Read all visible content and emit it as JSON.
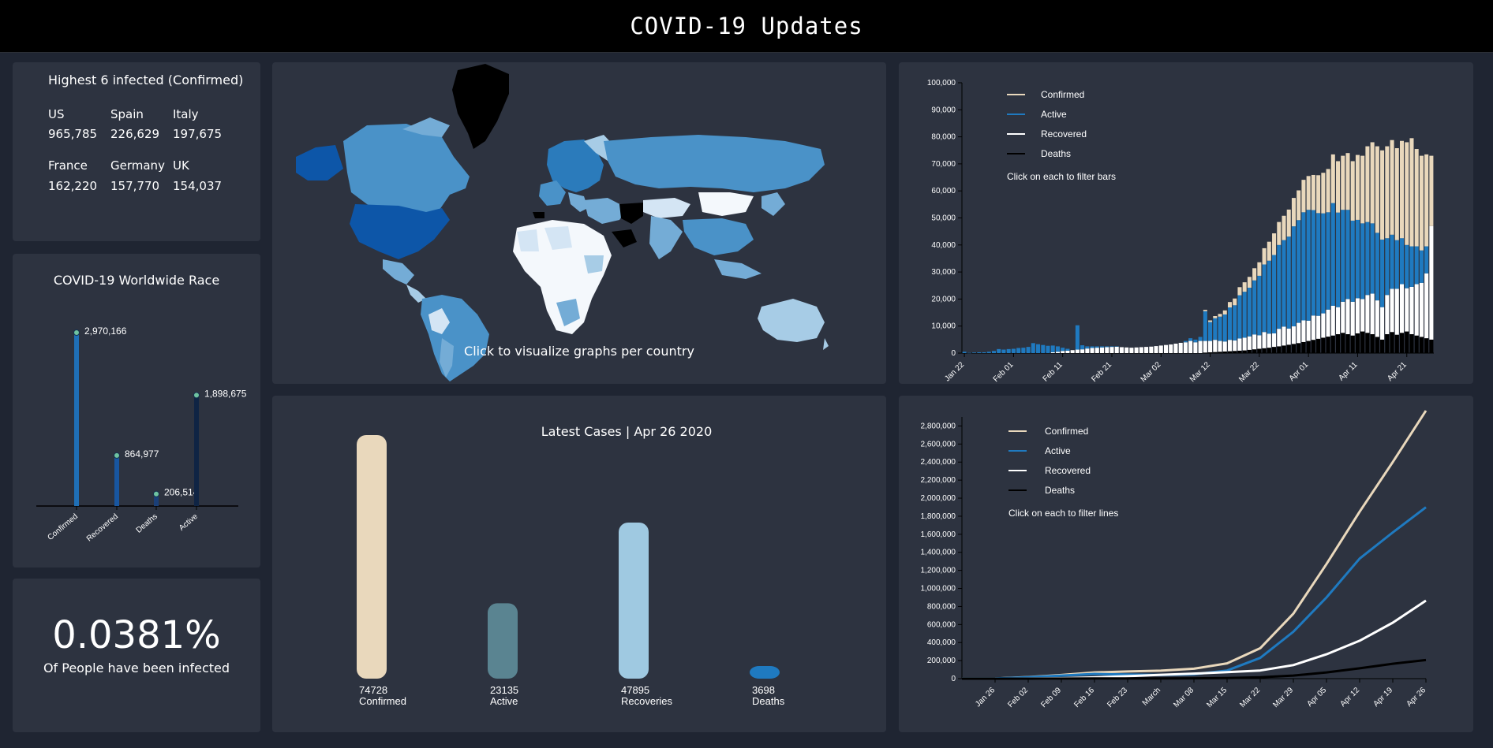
{
  "header": {
    "title": "COVID-19 Updates"
  },
  "top_infected": {
    "title": "Highest 6 infected (Confirmed)",
    "countries": [
      {
        "name": "US",
        "value": "965,785"
      },
      {
        "name": "Spain",
        "value": "226,629"
      },
      {
        "name": "Italy",
        "value": "197,675"
      },
      {
        "name": "France",
        "value": "162,220"
      },
      {
        "name": "Germany",
        "value": "157,770"
      },
      {
        "name": "UK",
        "value": "154,037"
      }
    ]
  },
  "map": {
    "hint": "Click to visualize graphs per country"
  },
  "percent": {
    "value": "0.0381%",
    "caption": "Of People have been infected"
  },
  "colors": {
    "confirmed": "#e9d8bc",
    "active": "#1f7ac0",
    "recovered": "#ffffff",
    "deaths": "#000000",
    "panel": "#2d3340",
    "background": "#1f2532",
    "latest_active": "#5a8491",
    "latest_recovered": "#9fc9e1",
    "latest_deaths": "#1f7ac0",
    "race_confirmed": "#1f6fb6",
    "race_recovered": "#1856a0",
    "race_deaths": "#1a3f78",
    "race_active": "#0f2444",
    "map_palette": [
      "#0d56a8",
      "#2b7bbb",
      "#4a92c8",
      "#74acd6",
      "#a7cce6",
      "#d4e5f4",
      "#f4f8fc",
      "#000000"
    ]
  },
  "chart_data": [
    {
      "id": "race",
      "type": "lollipop",
      "title": "COVID-19 Worldwide Race",
      "categories": [
        "Confirmed",
        "Recovered",
        "Deaths",
        "Active"
      ],
      "values": [
        2970166,
        864977,
        206514,
        1898675
      ],
      "value_labels": [
        "2,970,166",
        "864,977",
        "206,514",
        "1,898,675"
      ]
    },
    {
      "id": "latest",
      "type": "bar",
      "title": "Latest Cases | Apr 26 2020",
      "categories": [
        "Confirmed",
        "Active",
        "Recoveries",
        "Deaths"
      ],
      "values": [
        74728,
        23135,
        47895,
        3698
      ]
    },
    {
      "id": "daily",
      "type": "bar",
      "stacked": true,
      "ylim": [
        0,
        100000
      ],
      "yticks": [
        0,
        10000,
        20000,
        30000,
        40000,
        50000,
        60000,
        70000,
        80000,
        90000,
        100000
      ],
      "ytick_labels": [
        "0",
        "10,000",
        "20,000",
        "30,000",
        "40,000",
        "50,000",
        "60,000",
        "70,000",
        "80,000",
        "90,000",
        "100,000"
      ],
      "xtick_labels": [
        "Jan 22",
        "Feb 01",
        "Feb 11",
        "Feb 21",
        "Mar 02",
        "Mar 12",
        "Mar 22",
        "Apr 01",
        "Apr 11",
        "Apr 21"
      ],
      "legend": [
        "Confirmed",
        "Active",
        "Recovered",
        "Deaths"
      ],
      "legend_note": "Click on each to filter bars",
      "dates_start": "Jan 22",
      "series": [
        {
          "name": "Deaths",
          "values": [
            0,
            0,
            0,
            0,
            0,
            0,
            0,
            0,
            0,
            0,
            0,
            0,
            0,
            0,
            0,
            0,
            0,
            0,
            0,
            0,
            0,
            0,
            0,
            0,
            0,
            0,
            0,
            0,
            0,
            0,
            0,
            0,
            0,
            0,
            0,
            0,
            0,
            0,
            0,
            0,
            0,
            0,
            0,
            0,
            0,
            0,
            0,
            0,
            0,
            200,
            300,
            400,
            500,
            600,
            700,
            800,
            900,
            1000,
            1200,
            1400,
            1600,
            1800,
            2000,
            2300,
            2500,
            2800,
            3100,
            3400,
            3700,
            4100,
            4500,
            4900,
            5300,
            5700,
            6100,
            6500,
            7000,
            7500,
            7000,
            6500,
            7300,
            8000,
            7500,
            7000,
            6000,
            5000,
            7000,
            7800,
            6800,
            7500,
            8000,
            7000,
            6500,
            6000,
            5500,
            5000
          ]
        },
        {
          "name": "Recovered",
          "values": [
            0,
            0,
            0,
            0,
            0,
            0,
            0,
            0,
            0,
            0,
            0,
            0,
            0,
            0,
            0,
            0,
            0,
            0,
            300,
            500,
            800,
            900,
            1100,
            1300,
            1400,
            1700,
            1900,
            2000,
            2100,
            2200,
            2300,
            2400,
            2200,
            2100,
            2000,
            2100,
            2200,
            2300,
            2400,
            2600,
            2800,
            3000,
            3200,
            3500,
            3800,
            4000,
            4500,
            4000,
            4500,
            4300,
            4200,
            4500,
            4000,
            3700,
            4200,
            3900,
            4500,
            4700,
            5000,
            5500,
            5000,
            6000,
            5200,
            5000,
            6500,
            7000,
            6000,
            6500,
            7500,
            8000,
            7500,
            9000,
            8500,
            9000,
            10000,
            11000,
            10000,
            11500,
            13000,
            12500,
            13000,
            12000,
            14000,
            15000,
            13500,
            12000,
            14500,
            16000,
            17000,
            18000,
            16000,
            17500,
            19000,
            20000,
            24000,
            42000
          ]
        },
        {
          "name": "Active",
          "values": [
            500,
            100,
            200,
            300,
            300,
            500,
            800,
            1500,
            1300,
            1500,
            1600,
            1900,
            2000,
            2300,
            3700,
            3300,
            3000,
            2700,
            2500,
            2000,
            1200,
            700,
            0,
            9000,
            1500,
            800,
            600,
            500,
            400,
            300,
            200,
            100,
            0,
            0,
            0,
            0,
            0,
            0,
            0,
            0,
            0,
            0,
            0,
            0,
            0,
            500,
            1000,
            1000,
            1500,
            11000,
            7000,
            8000,
            9000,
            10000,
            12000,
            13000,
            16000,
            17000,
            18000,
            20000,
            22000,
            25000,
            27000,
            29000,
            31000,
            32000,
            34000,
            37000,
            38000,
            40000,
            41000,
            39000,
            38000,
            37000,
            36000,
            38000,
            35000,
            34000,
            33000,
            30000,
            29000,
            28000,
            27000,
            26000,
            25000,
            25000,
            21000,
            20000,
            18000,
            17000,
            16000,
            15000,
            14000,
            12000,
            10000,
            0
          ]
        },
        {
          "name": "Confirmed",
          "values": [
            0,
            0,
            0,
            0,
            0,
            0,
            0,
            0,
            0,
            0,
            0,
            0,
            0,
            0,
            0,
            0,
            0,
            0,
            0,
            0,
            0,
            0,
            0,
            0,
            0,
            0,
            0,
            0,
            0,
            0,
            0,
            0,
            0,
            0,
            0,
            0,
            0,
            0,
            0,
            0,
            0,
            0,
            0,
            0,
            0,
            0,
            0,
            0,
            0,
            500,
            600,
            800,
            1000,
            1500,
            2000,
            2500,
            3000,
            3500,
            4000,
            4500,
            5000,
            6000,
            7000,
            8000,
            8500,
            9000,
            10000,
            10500,
            11000,
            12000,
            12500,
            13000,
            14000,
            15000,
            16000,
            18000,
            19000,
            20000,
            21000,
            22000,
            24000,
            25000,
            28000,
            30000,
            32000,
            33000,
            34000,
            35000,
            34000,
            36000,
            38000,
            40000,
            36000,
            35000,
            34000,
            26000
          ]
        }
      ]
    },
    {
      "id": "cumulative",
      "type": "line",
      "ylim": [
        0,
        2900000
      ],
      "yticks": [
        0,
        200000,
        400000,
        600000,
        800000,
        1000000,
        1200000,
        1400000,
        1600000,
        1800000,
        2000000,
        2200000,
        2400000,
        2600000,
        2800000
      ],
      "ytick_labels": [
        "0",
        "200,000",
        "400,000",
        "600,000",
        "800,000",
        "1,000,000",
        "1,200,000",
        "1,400,000",
        "1,600,000",
        "1,800,000",
        "2,000,000",
        "2,200,000",
        "2,400,000",
        "2,600,000",
        "2,800,000"
      ],
      "xtick_labels": [
        "Jan 26",
        "Feb 02",
        "Feb 09",
        "Feb 16",
        "Feb 23",
        "March",
        "Mar 08",
        "Mar 15",
        "Mar 22",
        "Mar 29",
        "Apr 05",
        "Apr 12",
        "Apr 19",
        "Apr 26"
      ],
      "legend": [
        "Confirmed",
        "Active",
        "Recovered",
        "Deaths"
      ],
      "legend_note": "Click on each to filter lines",
      "x": [
        "Jan 22",
        "Jan 26",
        "Feb 02",
        "Feb 09",
        "Feb 16",
        "Feb 23",
        "Mar 01",
        "Mar 08",
        "Mar 15",
        "Mar 22",
        "Mar 29",
        "Apr 05",
        "Apr 12",
        "Apr 19",
        "Apr 26"
      ],
      "series": [
        {
          "name": "Confirmed",
          "values": [
            555,
            2100,
            17400,
            40500,
            69000,
            79300,
            88400,
            109800,
            169300,
            337000,
            720000,
            1270000,
            1850000,
            2400000,
            2970166
          ]
        },
        {
          "name": "Active",
          "values": [
            520,
            2000,
            16000,
            34000,
            52000,
            45000,
            40000,
            48000,
            90000,
            230000,
            520000,
            900000,
            1330000,
            1620000,
            1898675
          ]
        },
        {
          "name": "Recovered",
          "values": [
            30,
            50,
            500,
            4000,
            14000,
            27000,
            43000,
            56000,
            72000,
            90000,
            150000,
            270000,
            420000,
            620000,
            864977
          ]
        },
        {
          "name": "Deaths",
          "values": [
            17,
            56,
            360,
            900,
            1660,
            2460,
            3000,
            3800,
            6400,
            14600,
            34000,
            69000,
            114000,
            165000,
            206514
          ]
        }
      ]
    }
  ]
}
